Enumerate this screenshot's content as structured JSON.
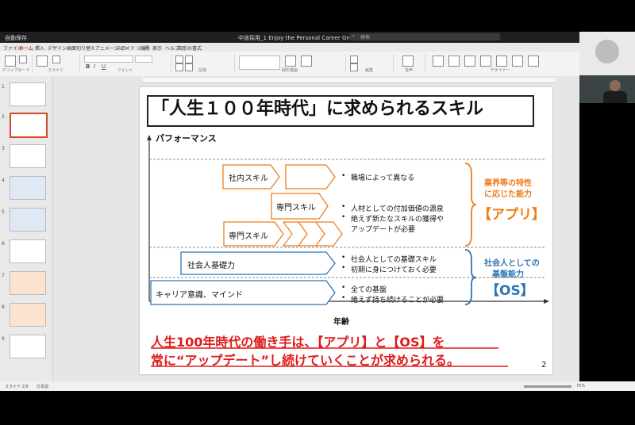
{
  "window": {
    "left_title": "自動保存",
    "doc_title": "中途採用_1 Enjoy the Personal Career Growth.pptx",
    "search_placeholder": "検索"
  },
  "ribbon": {
    "tabs": [
      "ファイル",
      "ホーム",
      "挿入",
      "デザイン",
      "画面切り替え",
      "アニメーション",
      "スライド ショー",
      "校閲",
      "表示",
      "ヘルプ",
      "図形の書式"
    ],
    "groups": [
      "クリップボード",
      "スライド",
      "フォント",
      "段落",
      "図形描画",
      "編集",
      "音声",
      "デザイナー"
    ]
  },
  "thumbnails": {
    "numbers": [
      "1",
      "2",
      "3",
      "4",
      "5",
      "6",
      "7",
      "8",
      "9"
    ]
  },
  "status": {
    "slide_info": "スライド 2/9",
    "language": "日本語",
    "zoom": "75%"
  },
  "slide": {
    "title": "「人生１００年時代」に求められるスキル",
    "y_axis_label": "パフォーマンス",
    "x_axis_label": "年齢",
    "boxes": {
      "shanai": "社内スキル",
      "senmon1": "専門スキル",
      "senmon2": "専門スキル",
      "shakaijin": "社会人基礎力",
      "career": "キャリア意識、マインド"
    },
    "bullets": {
      "b1": "職場によって異なる",
      "b2": "人材としての付加価値の源泉",
      "b3": "絶えず新たなスキルの獲得や",
      "b3b": "アップデートが必要",
      "b4": "社会人としての基礎スキル",
      "b5": "初期に身につけておく必要",
      "b6": "全ての基盤",
      "b7": "絶えず持ち続けることが必要"
    },
    "app_label_1": "業界等の特性",
    "app_label_2": "に応じた能力",
    "app_tag": "【アプリ】",
    "os_label_1": "社会人としての",
    "os_label_2": "基盤能力",
    "os_tag": "【OS】",
    "conclusion_1": "人生100年時代の働き手は、【アプリ】と【OS】を",
    "conclusion_2": "常に“アップデート”し続けていくことが求められる。",
    "page_number": "2"
  },
  "colors": {
    "orange": "#ef7d1a",
    "blue": "#2e74b5",
    "red": "#e01b1b",
    "selected_thumb": "#d04a2a"
  }
}
